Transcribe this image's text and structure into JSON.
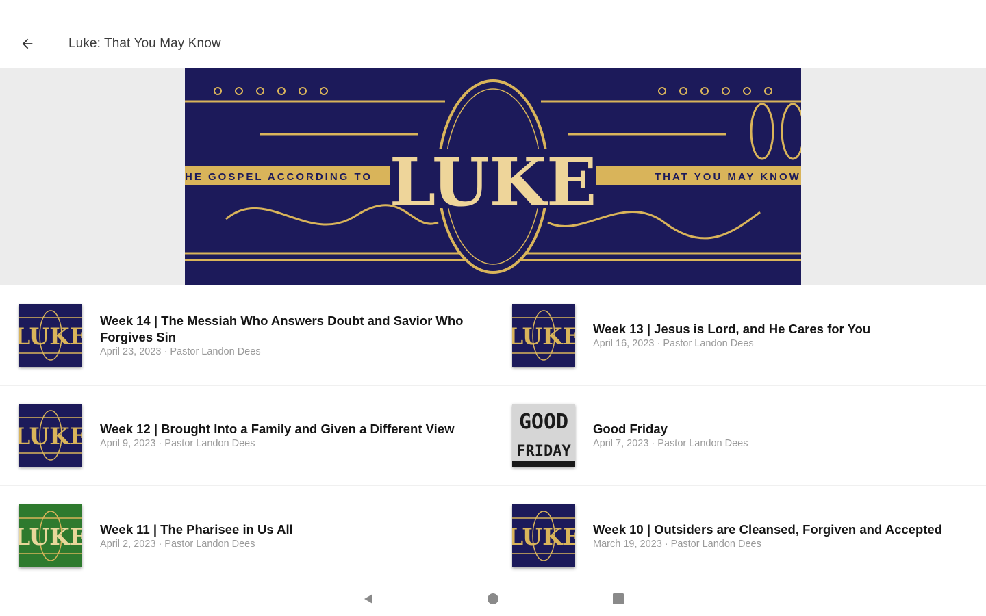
{
  "header": {
    "title": "Luke: That You May Know",
    "back_icon": "arrow-left-icon"
  },
  "banner": {
    "title": "LUKE",
    "left_text": "HE GOSPEL ACCORDING TO",
    "right_text": "THAT YOU MAY KNOW",
    "colors": {
      "background": "#1c1a5a",
      "gold": "#d9b45a"
    }
  },
  "sermons": [
    {
      "title": "Week 14 | The Messiah Who Answers Doubt and Savior Who Forgives Sin",
      "meta": "April 23, 2023 · Pastor Landon Dees",
      "thumb_text": "LUKE",
      "thumb_style": "navy"
    },
    {
      "title": "Week 13 | Jesus is Lord, and He Cares for You",
      "meta": "April 16, 2023 · Pastor Landon Dees",
      "thumb_text": "LUKE",
      "thumb_style": "navy"
    },
    {
      "title": "Week 12 | Brought Into a Family and Given a Different View",
      "meta": "April 9, 2023 · Pastor Landon Dees",
      "thumb_text": "LUKE",
      "thumb_style": "navy"
    },
    {
      "title": "Good Friday",
      "meta": "April 7, 2023 · Pastor Landon Dees",
      "thumb_text_1": "GOOD",
      "thumb_text_2": "FRIDAY",
      "thumb_style": "gray"
    },
    {
      "title": "Week 11 | The Pharisee in Us All",
      "meta": "April 2, 2023 · Pastor Landon Dees",
      "thumb_text": "LUKE",
      "thumb_style": "green"
    },
    {
      "title": "Week 10 | Outsiders are Cleansed, Forgiven and Accepted",
      "meta": "March 19, 2023 · Pastor Landon Dees",
      "thumb_text": "LUKE",
      "thumb_style": "navy"
    }
  ],
  "navbar": {
    "back_icon": "triangle-back-icon",
    "home_icon": "circle-home-icon",
    "recents_icon": "square-recents-icon"
  }
}
